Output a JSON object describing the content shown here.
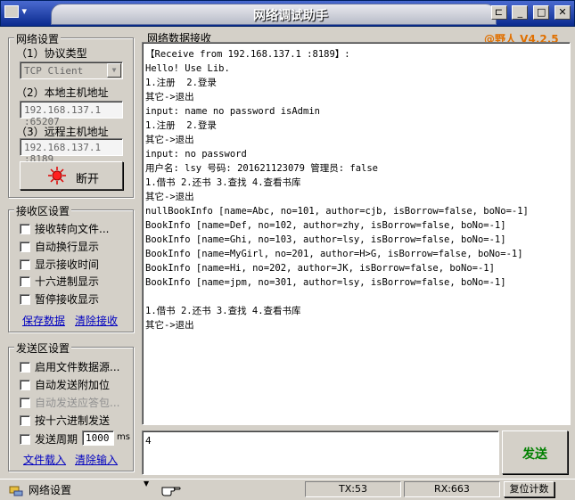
{
  "window": {
    "title": "网络调试助手",
    "sysmenu_arrow": "▾",
    "pin_glyph": "⊏",
    "min_glyph": "_",
    "max_glyph": "□",
    "close_glyph": "✕"
  },
  "settings": {
    "group_title": "网络设置",
    "protocol_label": "（1）协议类型",
    "protocol_value": "TCP Client",
    "local_label": "（2）本地主机地址",
    "local_value": "192.168.137.1 :65207",
    "remote_label": "（3）远程主机地址",
    "remote_value": "192.168.137.1 :8189",
    "disconnect_label": "断开"
  },
  "recv_settings": {
    "group_title": "接收区设置",
    "options": [
      "接收转向文件...",
      "自动换行显示",
      "显示接收时间",
      "十六进制显示",
      "暂停接收显示"
    ],
    "save_link": "保存数据",
    "clear_link": "清除接收"
  },
  "send_settings": {
    "group_title": "发送区设置",
    "options": [
      "启用文件数据源...",
      "自动发送附加位",
      "自动发送应答包...",
      "按十六进制发送"
    ],
    "period_label": "发送周期",
    "period_value": "1000",
    "period_unit": "ms",
    "load_link": "文件载入",
    "clear_input_link": "清除输入"
  },
  "recv": {
    "title": "网络数据接收",
    "version": "@野人 V4.2.5",
    "lines": [
      "【Receive from 192.168.137.1 :8189】:",
      "Hello! Use Lib.",
      "1.注册  2.登录",
      "其它->退出",
      "input: name no password isAdmin",
      "1.注册  2.登录",
      "其它->退出",
      "input: no password",
      "用户名: lsy 号码: 201621123079 管理员: false",
      "1.借书 2.还书 3.查找 4.查看书库",
      "其它->退出",
      "nullBookInfo [name=Abc, no=101, author=cjb, isBorrow=false, boNo=-1]",
      "BookInfo [name=Def, no=102, author=zhy, isBorrow=false, boNo=-1]",
      "BookInfo [name=Ghi, no=103, author=lsy, isBorrow=false, boNo=-1]",
      "BookInfo [name=MyGirl, no=201, author=H>G, isBorrow=false, boNo=-1]",
      "BookInfo [name=Hi, no=202, author=JK, isBorrow=false, boNo=-1]",
      "BookInfo [name=jpm, no=301, author=lsy, isBorrow=false, boNo=-1]",
      "",
      "1.借书 2.还书 3.查找 4.查看书库",
      "其它->退出"
    ]
  },
  "send": {
    "input_value": "4",
    "button_label": "发送"
  },
  "statusbar": {
    "left_label": "网络设置",
    "tx": "TX:53",
    "rx": "RX:663",
    "reset_label": "复位计数"
  },
  "colors": {
    "version_text": "#e07000",
    "send_button_text": "#008000",
    "link": "#0000c0"
  }
}
